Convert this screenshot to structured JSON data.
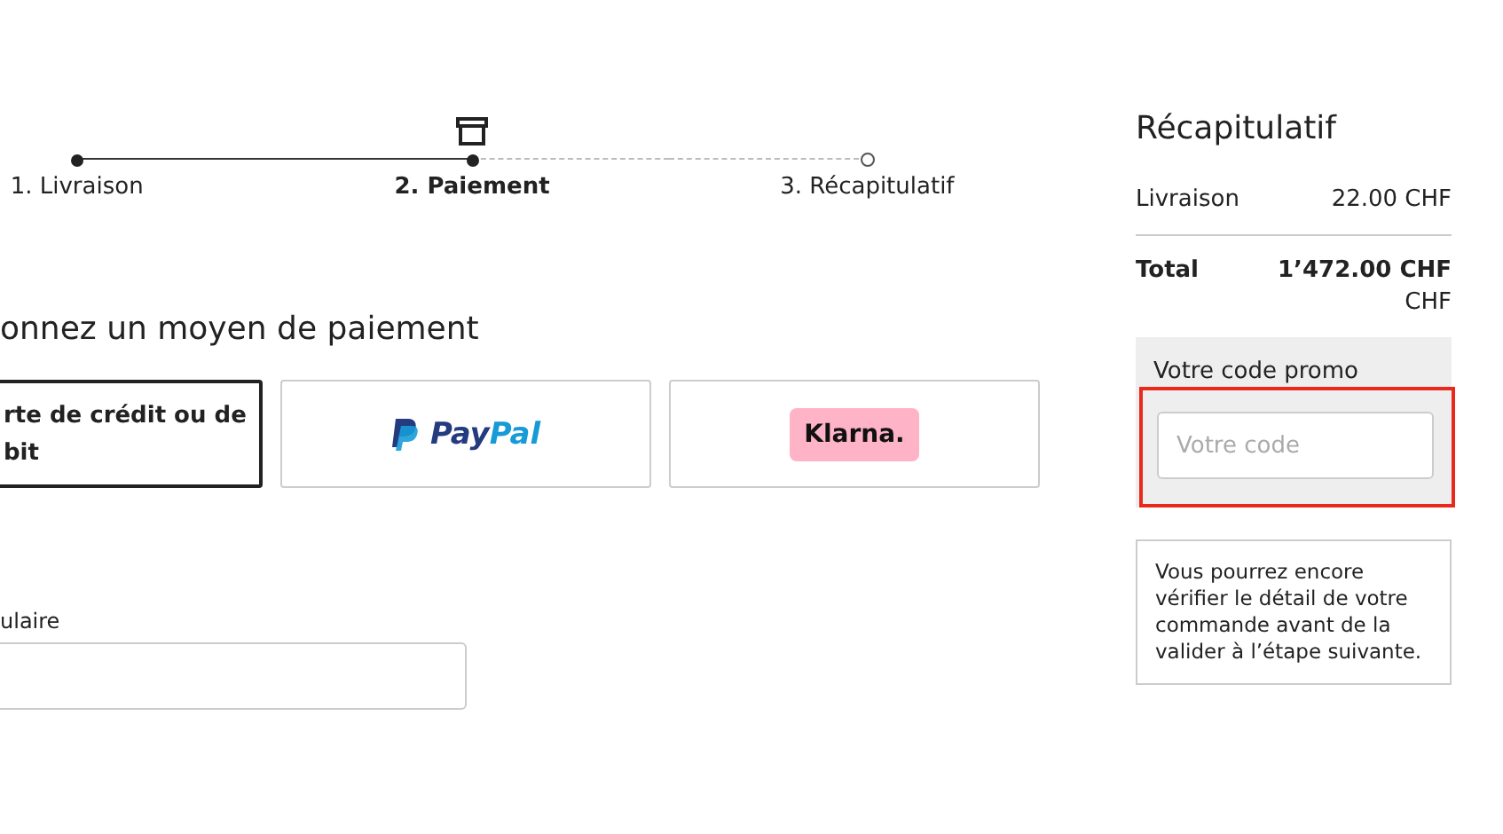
{
  "steps": [
    {
      "label": "1. Livraison",
      "completed": true,
      "selected": false
    },
    {
      "label": "2. Paiement",
      "completed": true,
      "selected": true
    },
    {
      "label": "3. Récapitulatif",
      "completed": false,
      "selected": false
    }
  ],
  "heading": "onnez un moyen de paiement",
  "payment_methods": [
    {
      "kind": "card",
      "lines": [
        "rte de crédit ou de",
        "bit"
      ],
      "selected": true
    },
    {
      "kind": "paypal",
      "logo_parts": [
        "Pay",
        "Pal"
      ],
      "selected": false
    },
    {
      "kind": "klarna",
      "logo": "Klarna.",
      "selected": false
    }
  ],
  "holder_field": {
    "label": "ulaire"
  },
  "summary": {
    "title": "Récapitulatif",
    "rows": [
      {
        "label": "Livraison",
        "value": "22.00 CHF",
        "bold": false
      },
      {
        "label": "Total",
        "value": "1’472.00 CHF",
        "bold": true,
        "extra": "CHF"
      }
    ],
    "promo": {
      "label": "Votre code promo",
      "placeholder": "Votre code",
      "highlighted": true
    },
    "note": "Vous pourrez encore vérifier le détail de votre commande avant de la valider à l’étape suivante."
  }
}
